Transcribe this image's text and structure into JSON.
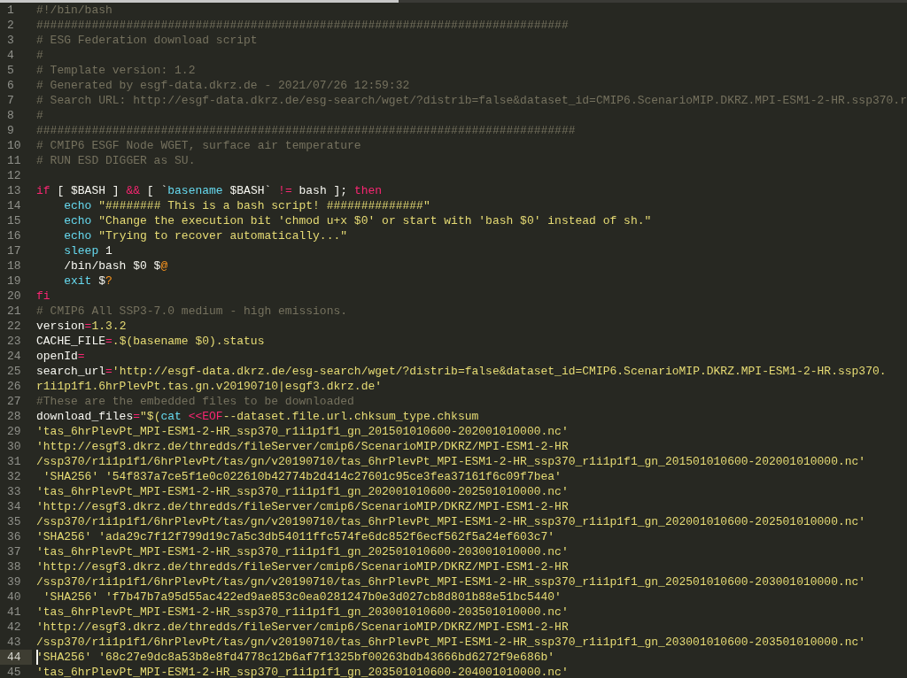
{
  "editor": {
    "lines": [
      {
        "number": "1",
        "current": false,
        "tokens": [
          {
            "kind": "comment",
            "text": "#!/bin/bash"
          }
        ]
      },
      {
        "number": "2",
        "current": false,
        "tokens": [
          {
            "kind": "comment",
            "text": "#############################################################################"
          }
        ]
      },
      {
        "number": "3",
        "current": false,
        "tokens": [
          {
            "kind": "comment",
            "text": "# ESG Federation download script"
          }
        ]
      },
      {
        "number": "4",
        "current": false,
        "tokens": [
          {
            "kind": "comment",
            "text": "#"
          }
        ]
      },
      {
        "number": "5",
        "current": false,
        "tokens": [
          {
            "kind": "comment",
            "text": "# Template version: 1.2"
          }
        ]
      },
      {
        "number": "6",
        "current": false,
        "tokens": [
          {
            "kind": "comment",
            "text": "# Generated by esgf-data.dkrz.de - 2021/07/26 12:59:32"
          }
        ]
      },
      {
        "number": "7",
        "current": false,
        "tokens": [
          {
            "kind": "comment",
            "text": "# Search URL: http://esgf-data.dkrz.de/esg-search/wget/?distrib=false&dataset_id=CMIP6.ScenarioMIP.DKRZ.MPI-ESM1-2-HR.ssp370.r"
          }
        ]
      },
      {
        "number": "8",
        "current": false,
        "tokens": [
          {
            "kind": "comment",
            "text": "#"
          }
        ]
      },
      {
        "number": "9",
        "current": false,
        "tokens": [
          {
            "kind": "comment",
            "text": "##############################################################################"
          }
        ]
      },
      {
        "number": "10",
        "current": false,
        "tokens": [
          {
            "kind": "comment",
            "text": "# CMIP6 ESGF Node WGET, surface air temperature"
          }
        ]
      },
      {
        "number": "11",
        "current": false,
        "tokens": [
          {
            "kind": "comment",
            "text": "# RUN ESD DIGGER as SU."
          }
        ]
      },
      {
        "number": "12",
        "current": false
      },
      {
        "number": "13",
        "current": false,
        "tokens": [
          {
            "kind": "keyword",
            "text": "if"
          },
          {
            "kind": "plain",
            "text": " [ $BASH ] "
          },
          {
            "kind": "keyword",
            "text": "&&"
          },
          {
            "kind": "plain",
            "text": " [ `"
          },
          {
            "kind": "builtin",
            "text": "basename"
          },
          {
            "kind": "plain",
            "text": " $BASH` "
          },
          {
            "kind": "keyword",
            "text": "!="
          },
          {
            "kind": "plain",
            "text": " bash ]; "
          },
          {
            "kind": "keyword",
            "text": "then"
          }
        ]
      },
      {
        "number": "14",
        "current": false,
        "tokens": [
          {
            "kind": "builtin",
            "text": "    echo"
          },
          {
            "kind": "string",
            "text": " \"######## This is a bash script! ##############\""
          }
        ]
      },
      {
        "number": "15",
        "current": false,
        "tokens": [
          {
            "kind": "builtin",
            "text": "    echo"
          },
          {
            "kind": "string",
            "text": " \"Change the execution bit 'chmod u+x $0' or start with 'bash $0' instead of sh.\""
          }
        ]
      },
      {
        "number": "16",
        "current": false,
        "tokens": [
          {
            "kind": "builtin",
            "text": "    echo"
          },
          {
            "kind": "string",
            "text": " \"Trying to recover automatically...\""
          }
        ]
      },
      {
        "number": "17",
        "current": false,
        "tokens": [
          {
            "kind": "builtin",
            "text": "    sleep"
          },
          {
            "kind": "plain",
            "text": " 1"
          }
        ]
      },
      {
        "number": "18",
        "current": false,
        "tokens": [
          {
            "kind": "plain",
            "text": "    /bin/bash $0 $"
          },
          {
            "kind": "special",
            "text": "@"
          }
        ]
      },
      {
        "number": "19",
        "current": false,
        "tokens": [
          {
            "kind": "builtin",
            "text": "    exit"
          },
          {
            "kind": "plain",
            "text": " $"
          },
          {
            "kind": "special",
            "text": "?"
          }
        ]
      },
      {
        "number": "20",
        "current": false,
        "tokens": [
          {
            "kind": "keyword",
            "text": "fi"
          }
        ]
      },
      {
        "number": "21",
        "current": false,
        "tokens": [
          {
            "kind": "comment",
            "text": "# CMIP6 All SSP3-7.0 medium - high emissions."
          }
        ]
      },
      {
        "number": "22",
        "current": false,
        "tokens": [
          {
            "kind": "plain",
            "text": "version"
          },
          {
            "kind": "keyword",
            "text": "="
          },
          {
            "kind": "string",
            "text": "1.3.2"
          }
        ]
      },
      {
        "number": "23",
        "current": false,
        "tokens": [
          {
            "kind": "plain",
            "text": "CACHE_FILE"
          },
          {
            "kind": "keyword",
            "text": "="
          },
          {
            "kind": "string",
            "text": ".$(basename $0).status"
          }
        ]
      },
      {
        "number": "24",
        "current": false,
        "tokens": [
          {
            "kind": "plain",
            "text": "openId"
          },
          {
            "kind": "keyword",
            "text": "="
          }
        ]
      },
      {
        "number": "25",
        "current": false,
        "tokens": [
          {
            "kind": "plain",
            "text": "search_url"
          },
          {
            "kind": "keyword",
            "text": "="
          },
          {
            "kind": "string",
            "text": "'http://esgf-data.dkrz.de/esg-search/wget/?distrib=false&dataset_id=CMIP6.ScenarioMIP.DKRZ.MPI-ESM1-2-HR.ssp370."
          }
        ]
      },
      {
        "number": "26",
        "current": false,
        "tokens": [
          {
            "kind": "string",
            "text": "r1i1p1f1.6hrPlevPt.tas.gn.v20190710|esgf3.dkrz.de'"
          }
        ]
      },
      {
        "number": "27",
        "current": false,
        "tokens": [
          {
            "kind": "comment",
            "text": "#These are the embedded files to be downloaded"
          }
        ]
      },
      {
        "number": "28",
        "current": false,
        "tokens": [
          {
            "kind": "plain",
            "text": "download_files"
          },
          {
            "kind": "keyword",
            "text": "="
          },
          {
            "kind": "string",
            "text": "\"$("
          },
          {
            "kind": "builtin",
            "text": "cat"
          },
          {
            "kind": "keyword",
            "text": " <<EOF"
          },
          {
            "kind": "string",
            "text": "--dataset.file.url.chksum_type.chksum"
          }
        ]
      },
      {
        "number": "29",
        "current": false,
        "tokens": [
          {
            "kind": "string",
            "text": "'tas_6hrPlevPt_MPI-ESM1-2-HR_ssp370_r1i1p1f1_gn_201501010600-202001010000.nc'"
          }
        ]
      },
      {
        "number": "30",
        "current": false,
        "tokens": [
          {
            "kind": "string",
            "text": "'http://esgf3.dkrz.de/thredds/fileServer/cmip6/ScenarioMIP/DKRZ/MPI-ESM1-2-HR"
          }
        ]
      },
      {
        "number": "31",
        "current": false,
        "tokens": [
          {
            "kind": "string",
            "text": "/ssp370/r1i1p1f1/6hrPlevPt/tas/gn/v20190710/tas_6hrPlevPt_MPI-ESM1-2-HR_ssp370_r1i1p1f1_gn_201501010600-202001010000.nc'"
          }
        ]
      },
      {
        "number": "32",
        "current": false,
        "tokens": [
          {
            "kind": "string",
            "text": " 'SHA256' '54f837a7ce5f1e0c022610b42774b2d414c27601c95ce3fea37161f6c09f7bea'"
          }
        ]
      },
      {
        "number": "33",
        "current": false,
        "tokens": [
          {
            "kind": "string",
            "text": "'tas_6hrPlevPt_MPI-ESM1-2-HR_ssp370_r1i1p1f1_gn_202001010600-202501010000.nc'"
          }
        ]
      },
      {
        "number": "34",
        "current": false,
        "tokens": [
          {
            "kind": "string",
            "text": "'http://esgf3.dkrz.de/thredds/fileServer/cmip6/ScenarioMIP/DKRZ/MPI-ESM1-2-HR"
          }
        ]
      },
      {
        "number": "35",
        "current": false,
        "tokens": [
          {
            "kind": "string",
            "text": "/ssp370/r1i1p1f1/6hrPlevPt/tas/gn/v20190710/tas_6hrPlevPt_MPI-ESM1-2-HR_ssp370_r1i1p1f1_gn_202001010600-202501010000.nc'"
          }
        ]
      },
      {
        "number": "36",
        "current": false,
        "tokens": [
          {
            "kind": "string",
            "text": "'SHA256' 'ada29c7f12f799d19c7a5c3db54011ffc574fe6dc852f6ecf562f5a24ef603c7'"
          }
        ]
      },
      {
        "number": "37",
        "current": false,
        "tokens": [
          {
            "kind": "string",
            "text": "'tas_6hrPlevPt_MPI-ESM1-2-HR_ssp370_r1i1p1f1_gn_202501010600-203001010000.nc'"
          }
        ]
      },
      {
        "number": "38",
        "current": false,
        "tokens": [
          {
            "kind": "string",
            "text": "'http://esgf3.dkrz.de/thredds/fileServer/cmip6/ScenarioMIP/DKRZ/MPI-ESM1-2-HR"
          }
        ]
      },
      {
        "number": "39",
        "current": false,
        "tokens": [
          {
            "kind": "string",
            "text": "/ssp370/r1i1p1f1/6hrPlevPt/tas/gn/v20190710/tas_6hrPlevPt_MPI-ESM1-2-HR_ssp370_r1i1p1f1_gn_202501010600-203001010000.nc'"
          }
        ]
      },
      {
        "number": "40",
        "current": false,
        "tokens": [
          {
            "kind": "string",
            "text": " 'SHA256' 'f7b47b7a95d55ac422ed9ae853c0ea0281247b0e3d027cb8d801b88e51bc5440'"
          }
        ]
      },
      {
        "number": "41",
        "current": false,
        "tokens": [
          {
            "kind": "string",
            "text": "'tas_6hrPlevPt_MPI-ESM1-2-HR_ssp370_r1i1p1f1_gn_203001010600-203501010000.nc'"
          }
        ]
      },
      {
        "number": "42",
        "current": false,
        "tokens": [
          {
            "kind": "string",
            "text": "'http://esgf3.dkrz.de/thredds/fileServer/cmip6/ScenarioMIP/DKRZ/MPI-ESM1-2-HR"
          }
        ]
      },
      {
        "number": "43",
        "current": false,
        "tokens": [
          {
            "kind": "string",
            "text": "/ssp370/r1i1p1f1/6hrPlevPt/tas/gn/v20190710/tas_6hrPlevPt_MPI-ESM1-2-HR_ssp370_r1i1p1f1_gn_203001010600-203501010000.nc'"
          }
        ]
      },
      {
        "number": "44",
        "current": true,
        "tokens": [
          {
            "kind": "string",
            "text": "'SHA256' '68c27e9dc8a53b8e8fd4778c12b6af7f1325bf00263bdb43666bd6272f9e686b'"
          }
        ]
      },
      {
        "number": "45",
        "current": false,
        "tokens": [
          {
            "kind": "string",
            "text": "'tas_6hrPlevPt_MPI-ESM1-2-HR_ssp370_r1i1p1f1_gn_203501010600-204001010000.nc'"
          }
        ]
      }
    ]
  }
}
